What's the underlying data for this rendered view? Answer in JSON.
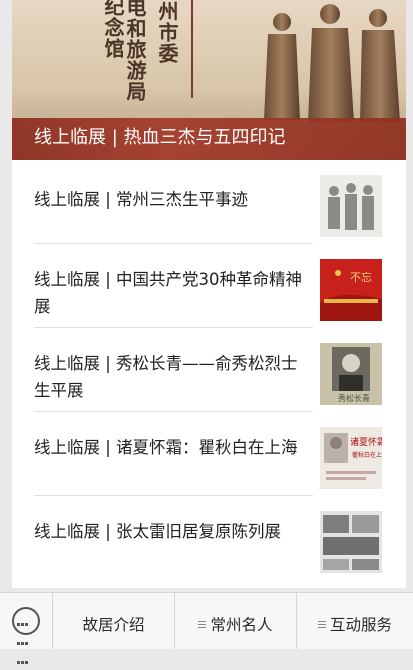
{
  "hero": {
    "vtext_left": "纪念馆",
    "vtext_mid": "广电和旅游局",
    "vtext_right": "常州市委",
    "caption": "线上临展 | 热血三杰与五四印记"
  },
  "exhibits": [
    {
      "title": "线上临展 | 常州三杰生平事迹",
      "thumb": "sanjie-photo"
    },
    {
      "title": "线上临展 | 中国共产党30种革命精神展",
      "thumb": "red-flag-poster"
    },
    {
      "title": "线上临展 | 秀松长青——俞秀松烈士生平展",
      "thumb": "portrait-poster"
    },
    {
      "title": "线上临展 | 诸夏怀霜：瞿秋白在上海",
      "thumb": "qiubai-cover"
    },
    {
      "title": "线上临展 | 张太雷旧居复原陈列展",
      "thumb": "building-photos"
    }
  ],
  "bottombar": {
    "menu1": "故居介绍",
    "menu2": "常州名人",
    "menu3": "互动服务"
  },
  "colors": {
    "caption_red": "#a43b2a",
    "bar_bg": "#f7f7f7"
  }
}
